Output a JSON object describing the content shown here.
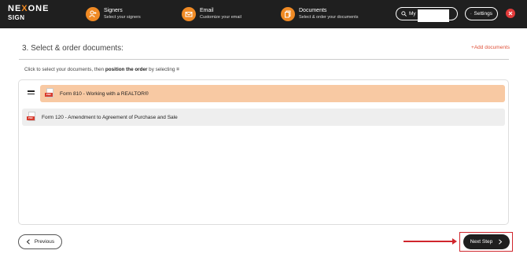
{
  "logo": {
    "line1_a": "NE",
    "line1_x": "X",
    "line1_b": "ONE",
    "line2": "SIGN"
  },
  "steps": [
    {
      "title": "Signers",
      "subtitle": "Select your signers",
      "icon": "user-add-icon"
    },
    {
      "title": "Email",
      "subtitle": "Customize your email",
      "icon": "envelope-icon"
    },
    {
      "title": "Documents",
      "subtitle": "Select & order your documents",
      "icon": "documents-icon"
    }
  ],
  "header": {
    "my_label": "My",
    "settings_label": "Settings"
  },
  "section": {
    "title": "3. Select & order documents:",
    "add_label": "Add documents",
    "add_plus": "+"
  },
  "instruction": {
    "before": "Click to select your documents, then ",
    "bold": "position the order",
    "after": " by selecting ",
    "symbol": "="
  },
  "documents": [
    {
      "name": "Form 810 - Working with a REALTOR®",
      "selected": true
    },
    {
      "name": "Form 120 - Amendment to Agreement of Purchase and Sale",
      "selected": false
    }
  ],
  "footer": {
    "previous_label": "Previous",
    "next_label": "Next Step"
  },
  "colors": {
    "accent": "#f08a24",
    "selected_row": "#f8c9a3",
    "highlight": "#d0262d"
  }
}
